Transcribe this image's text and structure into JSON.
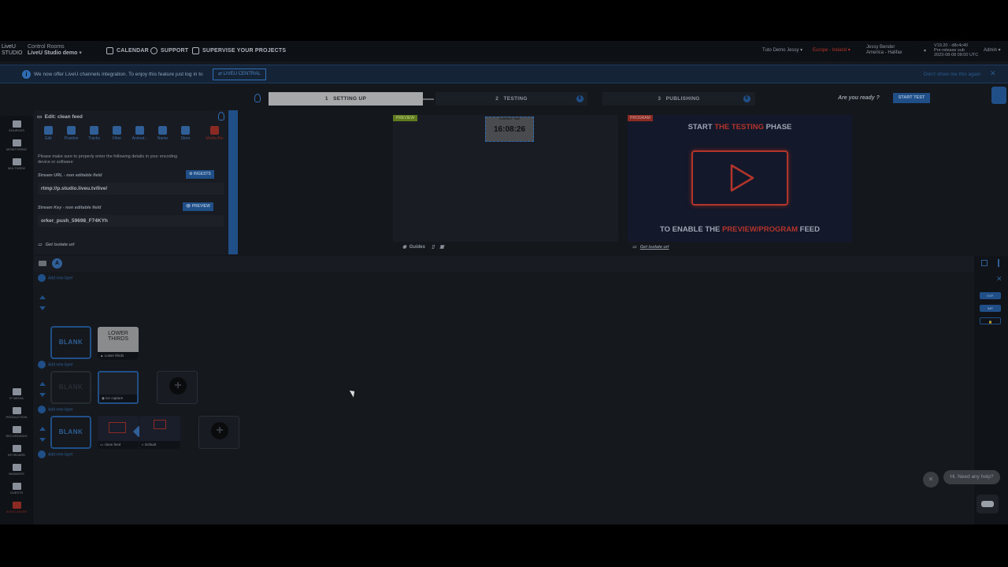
{
  "topbar": {
    "logo_line1": "LiveU",
    "logo_line2": "STUDIO",
    "control_rooms": "Control Rooms",
    "studio_name": "LiveU Studio demo",
    "nav": [
      {
        "label": "CALENDAR",
        "icon": "calendar-icon"
      },
      {
        "label": "SUPPORT",
        "icon": "support-icon"
      },
      {
        "label": "SUPERVISE YOUR PROJECTS",
        "icon": "grid-icon"
      }
    ],
    "tuto": "Tuto Demo Jessy ▾",
    "region": "Europe - Ireland ▾",
    "user_name": "Jessy Bender",
    "user_tz": "America - Halifax",
    "version": "V19.20 - d8c4c40",
    "version_sub": "Pre-release sub",
    "version_date": "2023-08-08 08:00 UTC",
    "admin": "Admin ▾"
  },
  "banner": {
    "message": "We now offer LiveU channels integration. To enjoy this feature just log in to",
    "link_label": "⇄ LIVEU CENTRAL",
    "dismiss": "Don't show me this again",
    "close": "✕"
  },
  "stepper": {
    "steps": [
      {
        "num": "1",
        "label": "SETTING UP",
        "active": true
      },
      {
        "num": "2",
        "label": "TESTING",
        "active": false
      },
      {
        "num": "3",
        "label": "PUBLISHING",
        "active": false
      }
    ],
    "step_badge": "€",
    "ready": "Are you ready ?",
    "start_test": "START TEST"
  },
  "sidebar": {
    "top": [
      "SOURCES",
      "MONITORING",
      "MULTIVIEW"
    ],
    "bottom": [
      "IP MEDIA",
      "PRODUCTION",
      "RECORDINGS",
      "KEYBOARD",
      "BANNERS",
      "GUESTS",
      "AUDIO MIXER"
    ]
  },
  "panel": {
    "title": "Edit: clean feed",
    "tools": [
      "Edit",
      "Position",
      "Tracks",
      "Filter",
      "Animat...",
      "Name",
      "Store",
      "Media Bin"
    ],
    "instructions_1": "Please make sure to properly enter the following details in your encoding",
    "instructions_2": "device or software",
    "stream_url_label": "Stream URL - non editable field",
    "ingests_btn": "⚙ INGESTS",
    "stream_url": "rtmp://p.studio.liveu.tv/live/",
    "stream_key_label": "Stream Key - non editable field",
    "preview_btn": "👁 PREVIEW",
    "stream_key": "orker_push_59698_F74KYh",
    "get_isolate": "Get isolate url"
  },
  "preview": {
    "tag": "PREVIEW",
    "clock": "16:08:26",
    "clock_small": "CURRENT TIME",
    "guides": "Guides"
  },
  "program": {
    "tag": "PROGRAM",
    "line1_a": "START ",
    "line1_b": "THE TESTING",
    "line1_c": " PHASE",
    "line2_a": "TO ENABLE THE ",
    "line2_b": "PREVIEW/PROGRAM",
    "line2_c": " FEED",
    "get_isolate": "Get isolate url"
  },
  "timeline": {
    "add_layer": "Add new layer",
    "blank": "BLANK",
    "lower_thirds_title": "LOWER THIRDS",
    "lower_thirds_cap": "Lower thirds",
    "ice_caption": "ice capture",
    "clean_feed_cap": "clean feed",
    "default_cap": "Default",
    "add": "+"
  },
  "right_sidebar": {
    "buttons": [
      "EXP.",
      "IMP.",
      "🔒"
    ]
  },
  "help": {
    "text": "Hi. Need any help?",
    "close": "✕"
  }
}
